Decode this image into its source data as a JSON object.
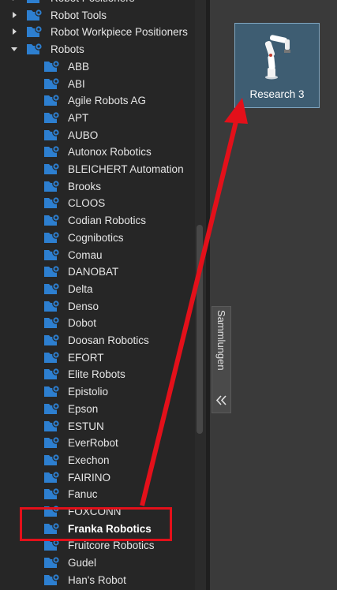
{
  "colors": {
    "panel_bg": "#262626",
    "main_bg": "#3a3a3a",
    "folder_blue": "#2d7fd0",
    "card_bg": "#3e5d72",
    "card_border": "#7fa6c1",
    "annotation_red": "#e3101a"
  },
  "tree": {
    "parents": [
      {
        "label": "Robot Positioners",
        "expanded": false
      },
      {
        "label": "Robot Tools",
        "expanded": false
      },
      {
        "label": "Robot Workpiece Positioners",
        "expanded": false
      },
      {
        "label": "Robots",
        "expanded": true
      }
    ],
    "children": [
      {
        "label": "ABB"
      },
      {
        "label": "ABI"
      },
      {
        "label": "Agile Robots AG"
      },
      {
        "label": "APT"
      },
      {
        "label": "AUBO"
      },
      {
        "label": "Autonox Robotics"
      },
      {
        "label": "BLEICHERT Automation"
      },
      {
        "label": "Brooks"
      },
      {
        "label": "CLOOS"
      },
      {
        "label": "Codian Robotics"
      },
      {
        "label": "Cognibotics"
      },
      {
        "label": "Comau"
      },
      {
        "label": "DANOBAT"
      },
      {
        "label": "Delta"
      },
      {
        "label": "Denso"
      },
      {
        "label": "Dobot"
      },
      {
        "label": "Doosan Robotics"
      },
      {
        "label": "EFORT"
      },
      {
        "label": "Elite Robots"
      },
      {
        "label": "Epistolio"
      },
      {
        "label": "Epson"
      },
      {
        "label": "ESTUN"
      },
      {
        "label": "EverRobot"
      },
      {
        "label": "Exechon"
      },
      {
        "label": "FAIRINO"
      },
      {
        "label": "Fanuc"
      },
      {
        "label": "FOXCONN"
      },
      {
        "label": "Franka Robotics",
        "bold": true
      },
      {
        "label": "Fruitcore Robotics"
      },
      {
        "label": "Gudel"
      },
      {
        "label": "Han's Robot"
      }
    ]
  },
  "collections_tab": {
    "label": "Sammlungen",
    "icon": "double-chevron-left-icon"
  },
  "card": {
    "label": "Research 3",
    "icon": "robot-arm-icon"
  },
  "annotation": {
    "highlighted_item": "Franka Robotics",
    "target": "Research 3"
  }
}
